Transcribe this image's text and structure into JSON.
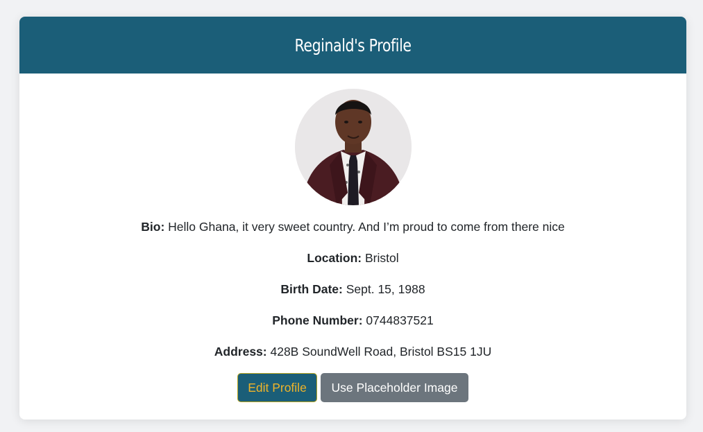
{
  "header": {
    "title": "Reginald's Profile"
  },
  "avatar": {
    "alt": "Profile photo"
  },
  "fields": [
    {
      "label": "Bio:",
      "value": " Hello Ghana, it very sweet country. And I’m proud to come from there nice"
    },
    {
      "label": "Location:",
      "value": " Bristol"
    },
    {
      "label": "Birth Date:",
      "value": " Sept. 15, 1988"
    },
    {
      "label": "Phone Number:",
      "value": " 0744837521"
    },
    {
      "label": "Address:",
      "value": " 428B SoundWell Road, Bristol BS15 1JU"
    }
  ],
  "buttons": {
    "edit_label": "Edit Profile",
    "placeholder_label": "Use Placeholder Image"
  },
  "colors": {
    "header_bg": "#1b5e78",
    "edit_text": "#f0b429",
    "secondary_bg": "#6c757d"
  }
}
